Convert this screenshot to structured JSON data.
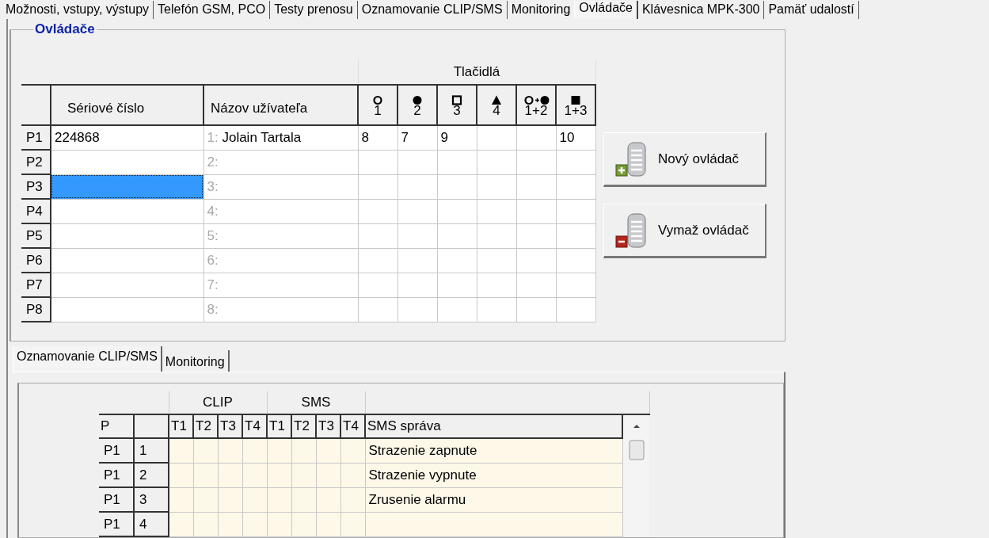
{
  "top_tabs": [
    {
      "label": "Možnosti, vstupy, výstupy",
      "selected": false
    },
    {
      "label": "Telefón GSM, PCO",
      "selected": false
    },
    {
      "label": "Testy prenosu",
      "selected": false
    },
    {
      "label": "Oznamovanie CLIP/SMS",
      "selected": false
    },
    {
      "label": "Monitoring",
      "selected": false
    },
    {
      "label": "Ovládače",
      "selected": true
    },
    {
      "label": "Klávesnica MPK-300",
      "selected": false
    },
    {
      "label": "Pamäť udalostí",
      "selected": false
    }
  ],
  "group": {
    "title": "Ovládače"
  },
  "remotes": {
    "group_header": "Tlačidlá",
    "columns": [
      {
        "label": "Sériové číslo"
      },
      {
        "label": "Názov užívateľa"
      }
    ],
    "button_columns": [
      {
        "kind": "ring",
        "label": "1"
      },
      {
        "kind": "dot",
        "label": "2"
      },
      {
        "kind": "square-outline",
        "label": "3"
      },
      {
        "kind": "triangle",
        "label": "4"
      },
      {
        "kind": "ring-plus-dot",
        "label": "1+2"
      },
      {
        "kind": "square",
        "label": "1+3"
      }
    ],
    "rows": [
      {
        "label": "P1",
        "serial": "224868",
        "index": "1:",
        "name": "Jolain Tartala",
        "buttons": [
          {
            "kind": "ring",
            "value": "8"
          },
          {
            "kind": "dot",
            "value": "7"
          },
          {
            "kind": "square-outline",
            "value": "9"
          },
          {
            "kind": "square",
            "value": "10"
          }
        ],
        "selected": false
      },
      {
        "label": "P2",
        "index": "2:",
        "selected": false
      },
      {
        "label": "P3",
        "index": "3:",
        "selected": true
      },
      {
        "label": "P4",
        "index": "4:",
        "selected": false
      },
      {
        "label": "P5",
        "index": "5:",
        "selected": false
      },
      {
        "label": "P6",
        "index": "6:",
        "selected": false
      },
      {
        "label": "P7",
        "index": "7:",
        "selected": false
      },
      {
        "label": "P8",
        "index": "8:",
        "selected": false
      }
    ]
  },
  "actions": [
    {
      "label": "Nový ovládač",
      "kind": "add"
    },
    {
      "label": "Vymaž ovládač",
      "kind": "remove"
    }
  ],
  "lower_tabs": [
    {
      "label": "Oznamovanie CLIP/SMS",
      "selected": true
    },
    {
      "label": "Monitoring",
      "selected": false
    }
  ],
  "notifications": {
    "group_headers": [
      {
        "label": "CLIP"
      },
      {
        "label": "SMS"
      }
    ],
    "p_header": "P",
    "clip_columns": [
      "T1",
      "T2",
      "T3",
      "T4"
    ],
    "sms_columns": [
      "T1",
      "T2",
      "T3",
      "T4"
    ],
    "message_header": "SMS správa",
    "rows": [
      {
        "remote": "P1",
        "event": "1",
        "message": "Strazenie zapnute"
      },
      {
        "remote": "P1",
        "event": "2",
        "message": "Strazenie vypnute"
      },
      {
        "remote": "P1",
        "event": "3",
        "message": "Zrusenie alarmu"
      },
      {
        "remote": "P1",
        "event": "4"
      }
    ]
  }
}
